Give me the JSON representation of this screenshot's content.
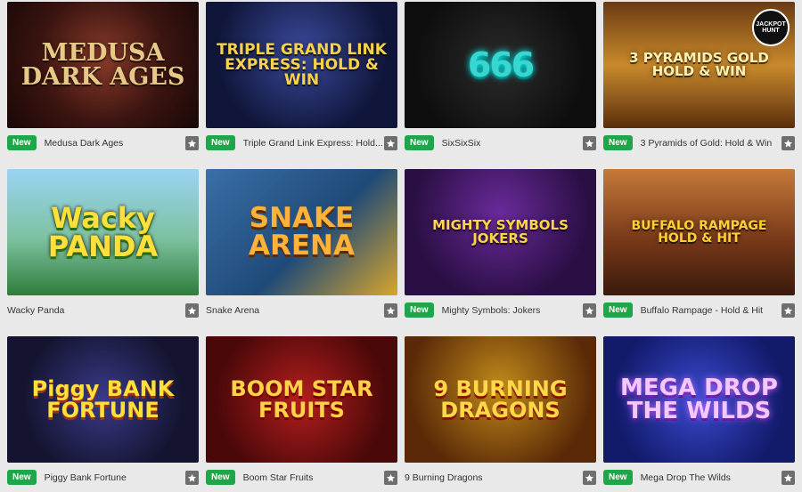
{
  "badge_label": "New",
  "games": [
    {
      "title": "Medusa Dark Ages",
      "art_text": "MEDUSA DARK AGES",
      "is_new": true
    },
    {
      "title": "Triple Grand Link Express: Hold...",
      "art_text": "TRIPLE GRAND LINK EXPRESS: HOLD & WIN",
      "is_new": true
    },
    {
      "title": "SixSixSix",
      "art_text": "666",
      "is_new": true
    },
    {
      "title": "3 Pyramids of Gold: Hold & Win",
      "art_text": "3 PYRAMIDS GOLD HOLD & WIN",
      "is_new": true
    },
    {
      "title": "Wacky Panda",
      "art_text": "Wacky PANDA",
      "is_new": false
    },
    {
      "title": "Snake Arena",
      "art_text": "SNAKE ARENA",
      "is_new": false
    },
    {
      "title": "Mighty Symbols: Jokers",
      "art_text": "MIGHTY SYMBOLS JOKERS",
      "is_new": true
    },
    {
      "title": "Buffalo Rampage - Hold & Hit",
      "art_text": "BUFFALO RAMPAGE HOLD & HIT",
      "is_new": true
    },
    {
      "title": "Piggy Bank Fortune",
      "art_text": "Piggy BANK FORTUNE",
      "is_new": true
    },
    {
      "title": "Boom Star Fruits",
      "art_text": "BOOM STAR FRUITS",
      "is_new": true
    },
    {
      "title": "9 Burning Dragons",
      "art_text": "9 BURNING DRAGONS",
      "is_new": false
    },
    {
      "title": "Mega Drop The Wilds",
      "art_text": "MEGA DROP THE WILDS",
      "is_new": true
    }
  ],
  "jackpot_badge": "JACKPOT HUNT",
  "icons": {
    "favorite": "bookmark-star-icon"
  }
}
